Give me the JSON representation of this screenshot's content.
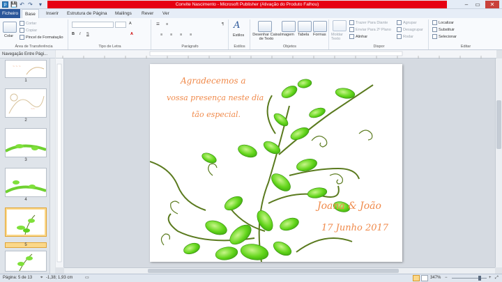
{
  "window": {
    "title": "Convite Nascimento - Microsoft Publisher (Ativação do Produto Falhou)"
  },
  "tabs": [
    "Ficheiro",
    "Base",
    "Inserir",
    "Estrutura de Página",
    "Mailings",
    "Rever",
    "Ver"
  ],
  "ribbon": {
    "clipboard": {
      "paste": "Colar",
      "cut": "Cortar",
      "copy": "Copiar",
      "format_painter": "Pincel de Formatação",
      "label": "Área de Transferência"
    },
    "font": {
      "font_size": "A",
      "label": "Tipo de Letra"
    },
    "paragraph": {
      "label": "Parágrafo"
    },
    "styles": {
      "btn": "Estilos",
      "label": "Estilos"
    },
    "objects": {
      "draw_text_box": "Desenhar Caixa de Texto",
      "image": "Imagem",
      "table": "Tabela",
      "shapes": "Formas",
      "label": "Objetos"
    },
    "arrange": {
      "wrap_text": "Moldar Texto",
      "bring_forward": "Trazer Para Diante",
      "send_backward": "Enviar Para 2º Plano",
      "align": "Alinhar",
      "group": "Agrupar",
      "ungroup": "Desagrupar",
      "rotate": "Rodar",
      "label": "Dispor"
    },
    "editing": {
      "find": "Localizar",
      "replace": "Substituir",
      "select": "Selecionar",
      "label": "Editar"
    }
  },
  "nav": {
    "title": "Navegação Entre Pági...",
    "pages": [
      "1",
      "2",
      "3",
      "4",
      "5",
      "6"
    ],
    "selected": "5"
  },
  "page": {
    "text_lines": [
      "Agradecemos a",
      "vossa presença neste dia",
      "tão especial."
    ],
    "names": "Joana & João",
    "date": "17 Junho 2017"
  },
  "status": {
    "page": "Página: 5 de 13",
    "coords": "-1,38; 1,93 cm",
    "zoom": "347%"
  },
  "colors": {
    "accent": "#2b579a",
    "script_text": "#f08a4b",
    "leaf": "#5fd11f",
    "vine": "#5a7a1e"
  }
}
